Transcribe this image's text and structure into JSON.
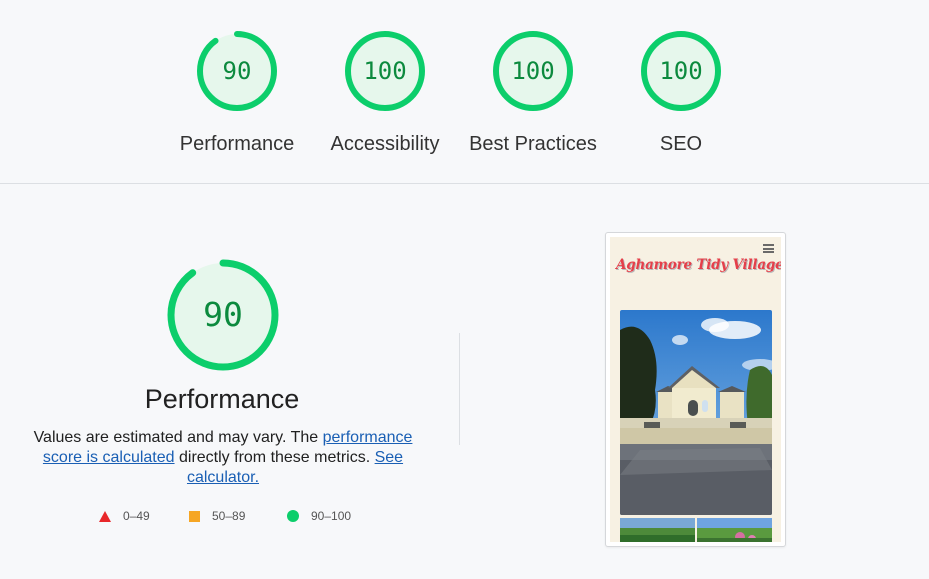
{
  "summary": {
    "categories": [
      {
        "label": "Performance",
        "score": "90",
        "value": 90
      },
      {
        "label": "Accessibility",
        "score": "100",
        "value": 100
      },
      {
        "label": "Best Practices",
        "score": "100",
        "value": 100
      },
      {
        "label": "SEO",
        "score": "100",
        "value": 100
      }
    ]
  },
  "performance": {
    "score": "90",
    "value": 90,
    "title": "Performance",
    "desc_text_1": "Values are estimated and may vary. The ",
    "desc_link_1": "performance score is calculated",
    "desc_text_2": " directly from these metrics. ",
    "desc_link_2": "See calculator."
  },
  "legend": [
    {
      "shape": "triangle",
      "range": "0–49",
      "color": "#e8272a"
    },
    {
      "shape": "square",
      "range": "50–89",
      "color": "#f6a624"
    },
    {
      "shape": "circle",
      "range": "90–100",
      "color": "#0cce6b"
    }
  ],
  "screenshot": {
    "site_title": "Aghamore Tidy Village"
  },
  "colors": {
    "pass": "#0cce6b",
    "pass_text": "#0c8a3e",
    "pass_fill": "#e6f7ec",
    "link": "#1a5fb4"
  }
}
